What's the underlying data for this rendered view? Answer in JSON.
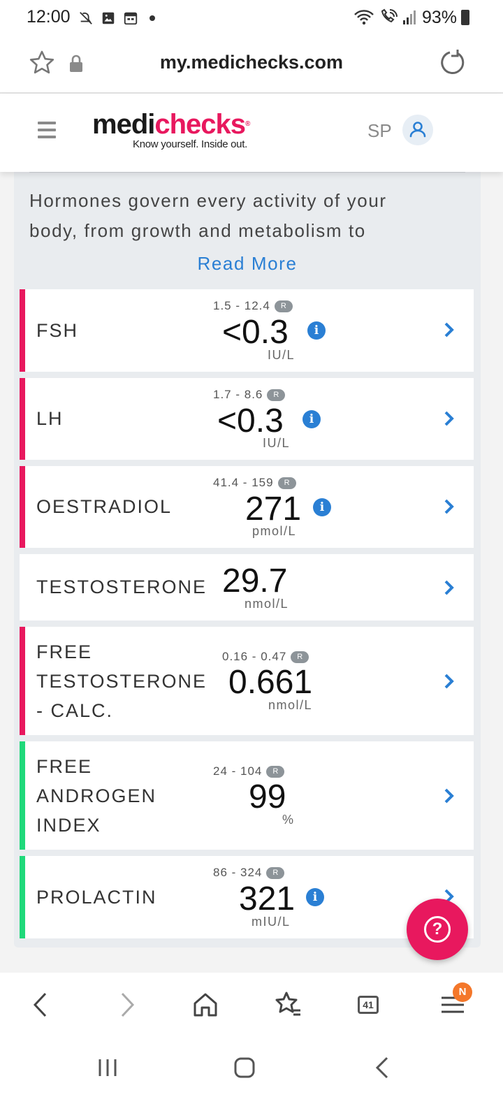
{
  "status_bar": {
    "time": "12:00",
    "battery": "93%",
    "icons": [
      "mute-icon",
      "gallery-icon",
      "calendar-icon",
      "wifi-icon",
      "wifi-calling-icon",
      "signal-icon",
      "battery-icon"
    ]
  },
  "url_bar": {
    "url": "my.medichecks.com"
  },
  "header": {
    "logo_part1": "medi",
    "logo_part2": "checks",
    "logo_mark": "®",
    "tagline": "Know yourself. Inside out.",
    "user_initials": "SP"
  },
  "intro": {
    "line1": "Hormones govern every activity of your",
    "line2": "body, from growth and metabolism to",
    "read_more": "Read More"
  },
  "range_badge": "R",
  "results": [
    {
      "name_lines": [
        "FSH"
      ],
      "range": "1.5 - 12.4",
      "value": "<0.3",
      "unit": "IU/L",
      "status": "out-of-range"
    },
    {
      "name_lines": [
        "LH"
      ],
      "range": "1.7 - 8.6",
      "value": "<0.3",
      "unit": "IU/L",
      "status": "out-of-range"
    },
    {
      "name_lines": [
        "OESTRADIOL"
      ],
      "range": "41.4 - 159",
      "value": "271",
      "unit": "pmol/L",
      "status": "out-of-range"
    },
    {
      "name_lines": [
        "TESTOSTERONE"
      ],
      "range": "",
      "value": "29.7",
      "unit": "nmol/L",
      "status": "none"
    },
    {
      "name_lines": [
        "FREE",
        "TESTOSTERONE",
        "- CALC."
      ],
      "range": "0.16 - 0.47",
      "value": "0.661",
      "unit": "nmol/L",
      "status": "out-of-range"
    },
    {
      "name_lines": [
        "FREE",
        "ANDROGEN",
        "INDEX"
      ],
      "range": "24 - 104",
      "value": "99",
      "unit": "%",
      "status": "in-range"
    },
    {
      "name_lines": [
        "PROLACTIN"
      ],
      "range": "86 - 324",
      "value": "321",
      "unit": "mIU/L",
      "status": "in-range"
    }
  ],
  "colors": {
    "brand_pink": "#e8185e",
    "out_of_range": "#e8185e",
    "in_range": "#1fd97a",
    "link_blue": "#2a7fd4"
  },
  "help_button": {
    "icon": "help-icon"
  },
  "browser_nav": {
    "tab_count": "41",
    "menu_badge": "N"
  }
}
